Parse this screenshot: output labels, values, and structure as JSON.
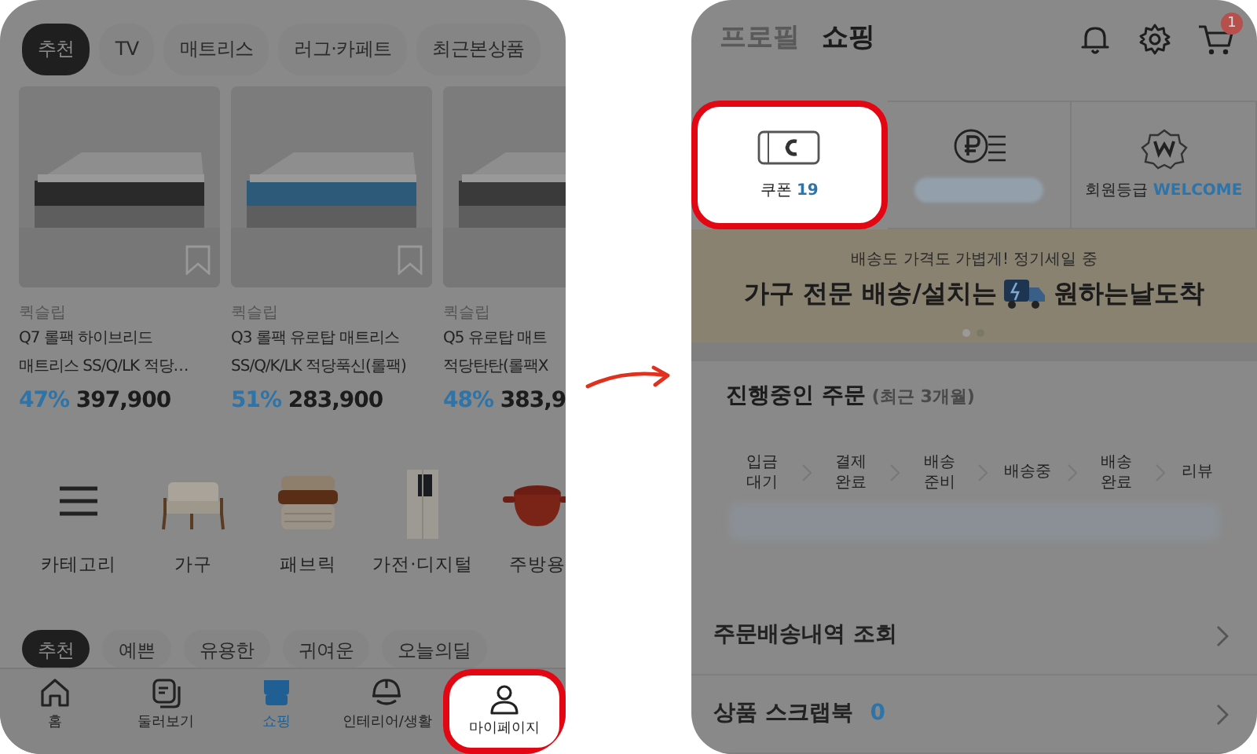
{
  "left_screen": {
    "top_tabs": [
      {
        "label": "추천",
        "selected": true
      },
      {
        "label": "TV",
        "selected": false
      },
      {
        "label": "매트리스",
        "selected": false
      },
      {
        "label": "러그·카페트",
        "selected": false
      },
      {
        "label": "최근본상품",
        "selected": false
      }
    ],
    "products": [
      {
        "brand": "퀵슬립",
        "title": [
          "Q7 롤팩 하이브리드",
          "매트리스 SS/Q/LK 적당…"
        ],
        "discount": "47%",
        "price": "397,900"
      },
      {
        "brand": "퀵슬립",
        "title": [
          "Q3 롤팩 유로탑 매트리스",
          "SS/Q/K/LK 적당푹신(롤팩)"
        ],
        "discount": "51%",
        "price": "283,900"
      },
      {
        "brand": "퀵슬립",
        "title": [
          "Q5 유로탑 매트",
          "적당탄탄(롤팩X"
        ],
        "discount": "48%",
        "price": "383,9"
      }
    ],
    "categories": [
      {
        "kind": "menu",
        "label": "카테고리"
      },
      {
        "kind": "sofa",
        "label": "가구"
      },
      {
        "kind": "fabric",
        "label": "패브릭"
      },
      {
        "kind": "fridge",
        "label": "가전·디지털"
      },
      {
        "kind": "pot",
        "label": "주방용"
      }
    ],
    "feed_tabs": [
      {
        "label": "추천",
        "selected": true
      },
      {
        "label": "예쁜",
        "selected": false
      },
      {
        "label": "유용한",
        "selected": false
      },
      {
        "label": "귀여운",
        "selected": false
      },
      {
        "label": "오늘의딜",
        "selected": false
      }
    ],
    "bottom_nav": [
      {
        "kind": "home",
        "label": "홈",
        "selected": false,
        "highlighted": false
      },
      {
        "kind": "browse",
        "label": "둘러보기",
        "selected": false,
        "highlighted": false
      },
      {
        "kind": "shop",
        "label": "쇼핑",
        "selected": true,
        "highlighted": false
      },
      {
        "kind": "helmet",
        "label": "인테리어/생활",
        "selected": false,
        "highlighted": false
      },
      {
        "kind": "person",
        "label": "마이페이지",
        "selected": false,
        "highlighted": true
      }
    ]
  },
  "right_screen": {
    "header_tabs": [
      {
        "label": "프로필",
        "selected": false
      },
      {
        "label": "쇼핑",
        "selected": true
      }
    ],
    "cart_badge": "1",
    "tiles": [
      {
        "kind": "coupon",
        "label": "쿠폰",
        "value": "19",
        "highlighted": true
      },
      {
        "kind": "points",
        "highlighted": false
      },
      {
        "kind": "grade",
        "label": "회원등급",
        "value": "WELCOME",
        "highlighted": false
      }
    ],
    "banner": {
      "subtitle": "배송도 가격도 가볍게! 정기세일 중",
      "title_before": "가구 전문 배송/설치는",
      "title_after": "원하는날도착"
    },
    "orders": {
      "title": "진행중인 주문",
      "subtitle": "(최근 3개월)",
      "steps": [
        "입금 대기",
        "결제 완료",
        "배송 준비",
        "배송중",
        "배송 완료",
        "리뷰"
      ]
    },
    "menu": [
      {
        "label": "주문배송내역 조회"
      },
      {
        "label": "상품 스크랩북",
        "count": "0"
      }
    ]
  }
}
